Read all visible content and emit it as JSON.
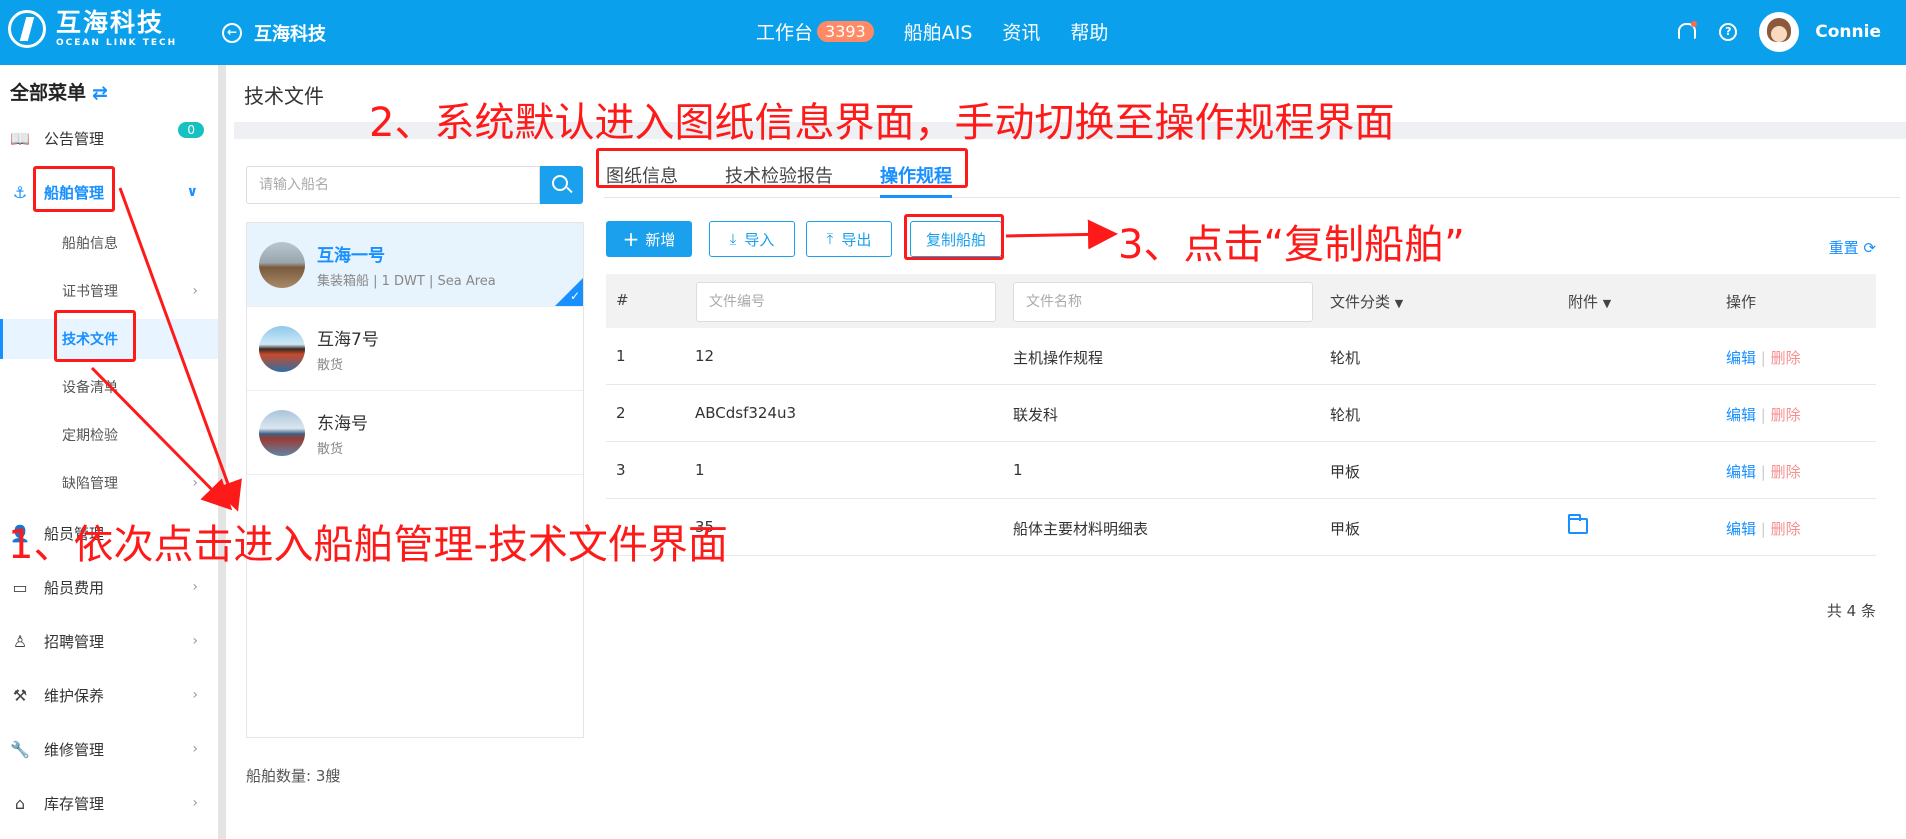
{
  "topbar": {
    "brand_cn": "互海科技",
    "brand_en": "OCEAN LINK TECH",
    "back_label": "互海科技",
    "nav": [
      {
        "label": "工作台",
        "badge": "3393"
      },
      {
        "label": "船舶AIS"
      },
      {
        "label": "资讯"
      },
      {
        "label": "帮助"
      }
    ],
    "username": "Connie",
    "accent_color": "#0aa0ec"
  },
  "sidebar": {
    "title": "全部菜单",
    "swap_icon": "⇄",
    "notice": {
      "label": "公告管理",
      "badge": "0"
    },
    "ship_mgmt": "船舶管理",
    "subitems": [
      "船舶信息",
      "证书管理",
      "技术文件",
      "设备清单",
      "定期检验",
      "缺陷管理"
    ],
    "items": [
      "船员管理",
      "船员费用",
      "招聘管理",
      "维护保养",
      "维修管理",
      "库存管理"
    ]
  },
  "page": {
    "title": "技术文件"
  },
  "ship_panel": {
    "search_placeholder": "请输入船名",
    "ships": [
      {
        "name": "互海一号",
        "meta": "集装箱船 | 1 DWT | Sea Area"
      },
      {
        "name": "互海7号",
        "meta": "散货"
      },
      {
        "name": "东海号",
        "meta": "散货"
      }
    ],
    "count_label": "船舶数量: 3艘"
  },
  "tabs": [
    "图纸信息",
    "技术检验报告",
    "操作规程"
  ],
  "toolbar": {
    "add": "新增",
    "import": "导入",
    "export": "导出",
    "copy": "复制船舶",
    "reset": "重置"
  },
  "table": {
    "headers": {
      "index": "#",
      "doc_no_placeholder": "文件编号",
      "doc_name_placeholder": "文件名称",
      "category": "文件分类",
      "attachment": "附件",
      "action": "操作"
    },
    "rows": [
      {
        "index": "1",
        "doc_no": "12",
        "doc_name": "主机操作规程",
        "category": "轮机",
        "edit": "编辑",
        "delete": "删除"
      },
      {
        "index": "2",
        "doc_no": "ABCdsf324u3",
        "doc_name": "联发科",
        "category": "轮机",
        "edit": "编辑",
        "delete": "删除"
      },
      {
        "index": "3",
        "doc_no": "1",
        "doc_name": "1",
        "category": "甲板",
        "edit": "编辑",
        "delete": "删除"
      },
      {
        "index": "",
        "doc_no": "35",
        "doc_name": "船体主要材料明细表",
        "category": "甲板",
        "edit": "编辑",
        "delete": "删除"
      }
    ],
    "total": "共 4 条"
  },
  "annotations": {
    "step1": "1、依次点击进入船舶管理-技术文件界面",
    "step2": "2、系统默认进入图纸信息界面，手动切换至操作规程界面",
    "step3": "3、点击“复制船舶”",
    "color": "#ff1a1a"
  }
}
